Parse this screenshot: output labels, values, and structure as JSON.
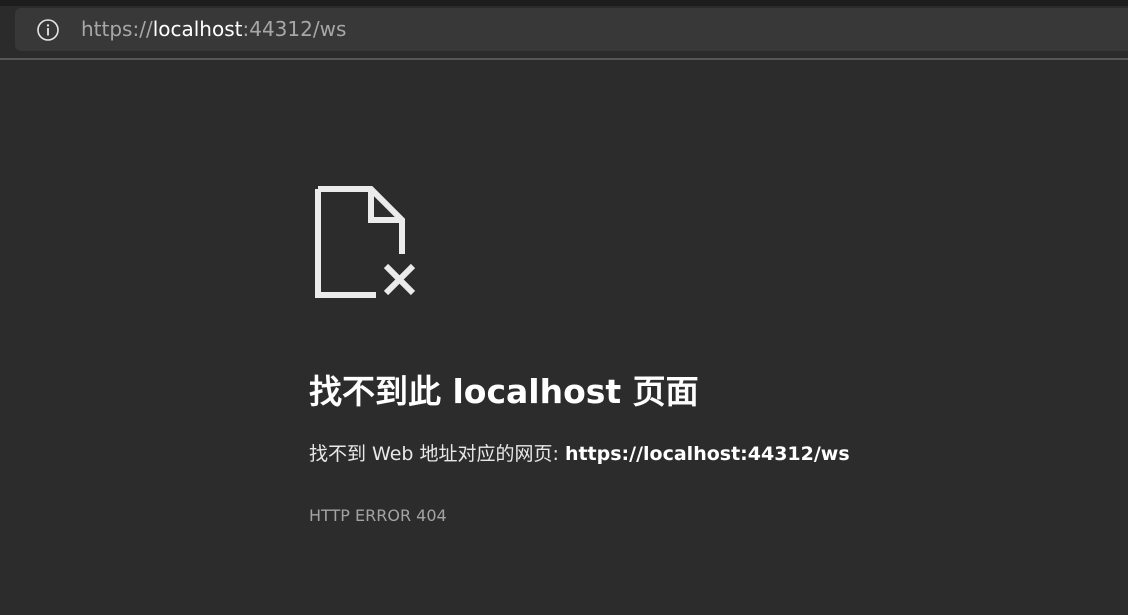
{
  "address_bar": {
    "icon": "info-icon",
    "url_prefix": "https://",
    "url_host": "localhost",
    "url_suffix": ":44312/ws"
  },
  "error_page": {
    "icon": "file-not-found-icon",
    "title": "找不到此 localhost 页面",
    "description_prefix": "找不到 Web 地址对应的网页: ",
    "description_url": "https://localhost:44312/ws",
    "error_code": "HTTP ERROR 404"
  },
  "colors": {
    "background": "#2c2c2c",
    "address_bar_background": "#383838",
    "text_primary": "#ffffff",
    "text_secondary": "#a3a3a3"
  }
}
